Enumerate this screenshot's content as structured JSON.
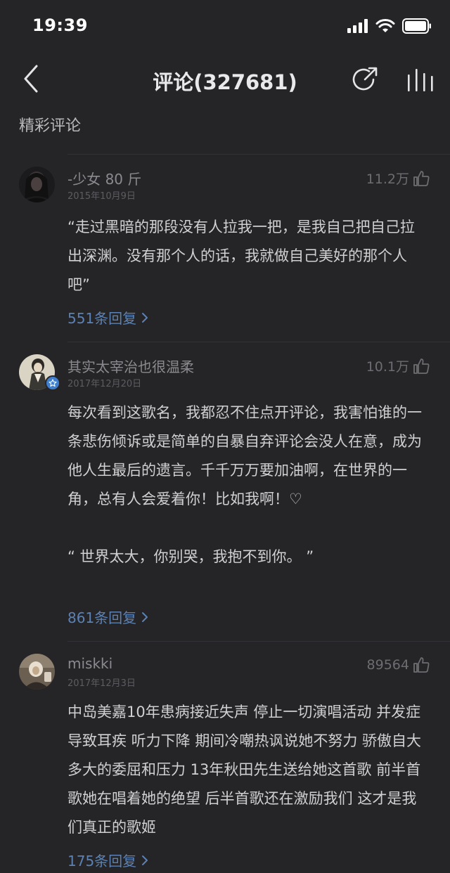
{
  "status": {
    "time": "19:39"
  },
  "header": {
    "title": "评论(327681)"
  },
  "section": {
    "title": "精彩评论"
  },
  "comments": [
    {
      "username": "-少女 80 斤",
      "date": "2015年10月9日",
      "likes": "11.2万",
      "text": "“走过黑暗的那段没有人拉我一把，是我自己把自己拉出深渊。没有那个人的话，我就做自己美好的那个人吧”",
      "replies": "551条回复"
    },
    {
      "username": "其实太宰治也很温柔",
      "date": "2017年12月20日",
      "likes": "10.1万",
      "text": "每次看到这歌名，我都忍不住点开评论，我害怕谁的一条悲伤倾诉或是简单的自暴自弃评论会没人在意，成为他人生最后的遗言。千千万万要加油啊，在世界的一角，总有人会爱着你！比如我啊！♡\n\n“ 世界太大，你别哭，我抱不到你。 ”",
      "replies": "861条回复"
    },
    {
      "username": "miskki",
      "date": "2017年12月3日",
      "likes": "89564",
      "text": "中岛美嘉10年患病接近失声 停止一切演唱活动 并发症导致耳疾 听力下降 期间冷嘲热讽说她不努力 骄傲自大 多大的委屈和压力 13年秋田先生送给她这首歌 前半首歌她在唱着她的绝望 后半首歌还在激励我们 这才是我们真正的歌姬",
      "replies": "175条回复"
    }
  ]
}
